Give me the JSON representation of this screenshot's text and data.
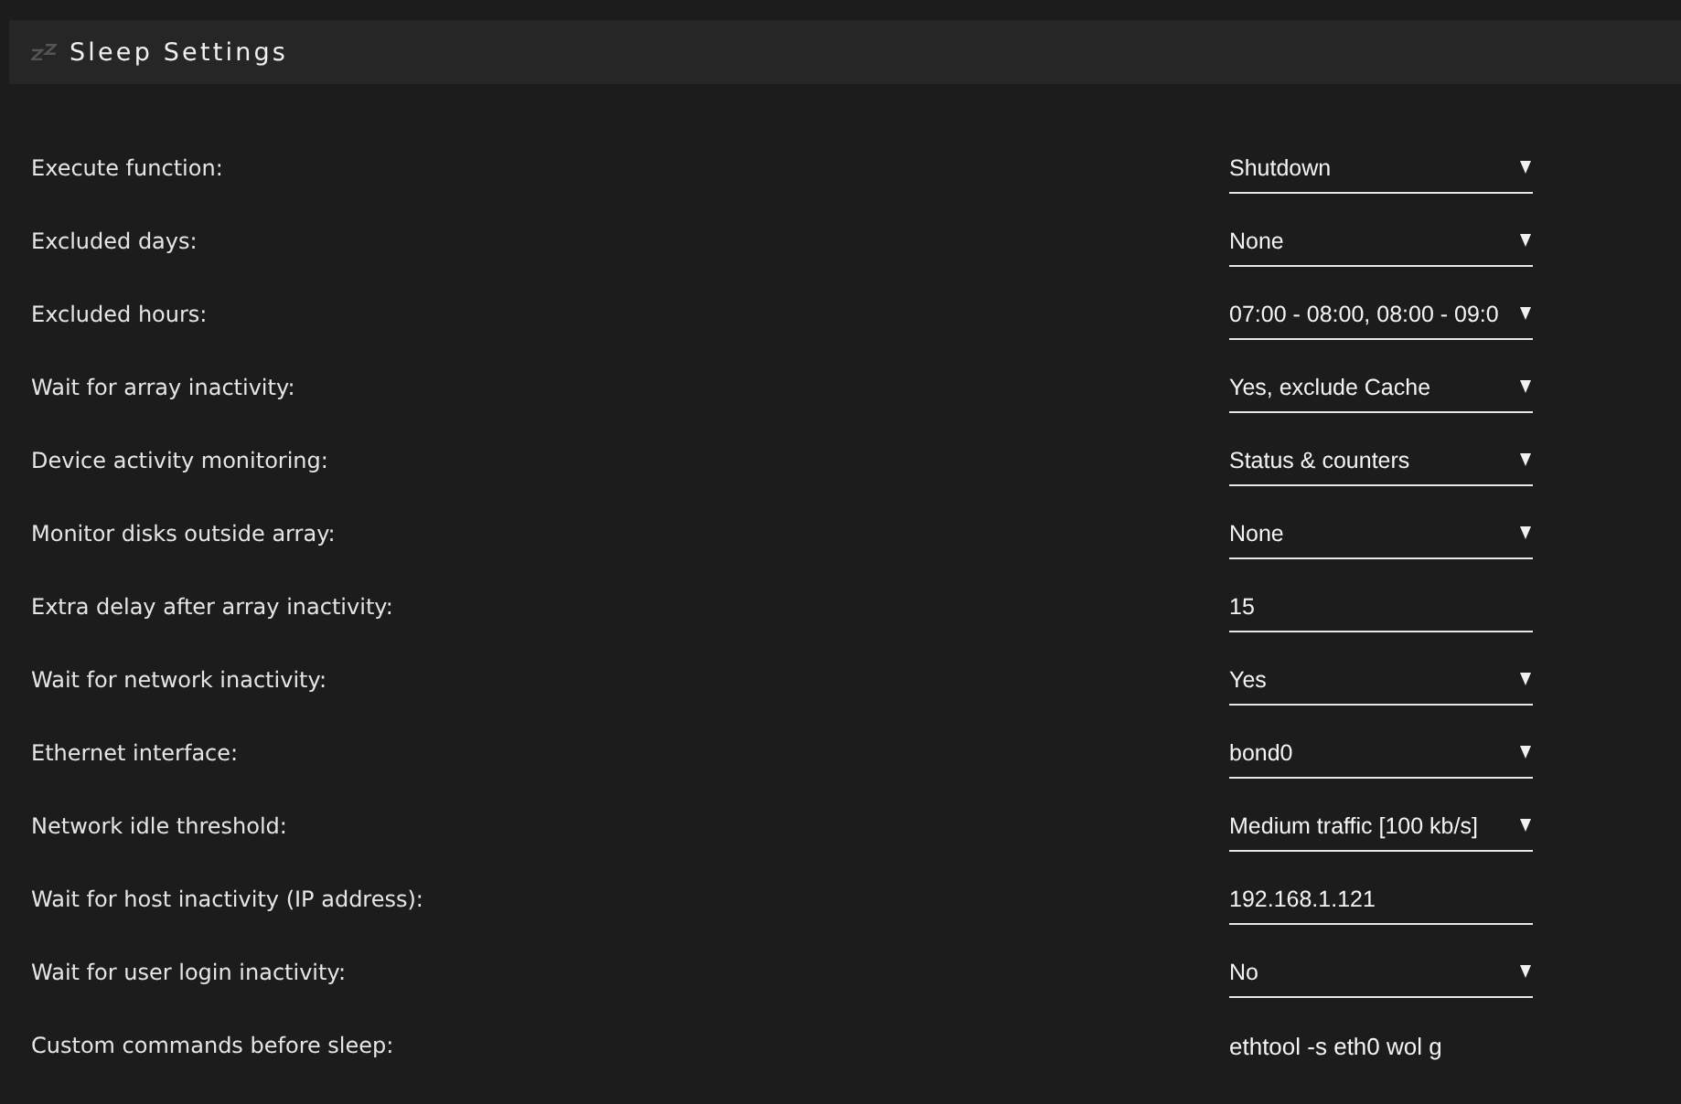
{
  "header": {
    "title": "Sleep Settings"
  },
  "settings": [
    {
      "label": "Execute function:",
      "kind": "select",
      "value": "Shutdown"
    },
    {
      "label": "Excluded days:",
      "kind": "select",
      "value": "None"
    },
    {
      "label": "Excluded hours:",
      "kind": "select",
      "value": "07:00 - 08:00, 08:00 - 09:0"
    },
    {
      "label": "Wait for array inactivity:",
      "kind": "select",
      "value": "Yes, exclude Cache"
    },
    {
      "label": "Device activity monitoring:",
      "kind": "select",
      "value": "Status & counters"
    },
    {
      "label": "Monitor disks outside array:",
      "kind": "select",
      "value": "None"
    },
    {
      "label": "Extra delay after array inactivity:",
      "kind": "input",
      "value": "15"
    },
    {
      "label": "Wait for network inactivity:",
      "kind": "select",
      "value": "Yes"
    },
    {
      "label": "Ethernet interface:",
      "kind": "select",
      "value": "bond0"
    },
    {
      "label": "Network idle threshold:",
      "kind": "select",
      "value": "Medium traffic [100 kb/s]"
    },
    {
      "label": "Wait for host inactivity (IP address):",
      "kind": "input",
      "value": "192.168.1.121"
    },
    {
      "label": "Wait for user login inactivity:",
      "kind": "select",
      "value": "No"
    },
    {
      "label": "Custom commands before sleep:",
      "kind": "text",
      "value": "ethtool -s eth0 wol g"
    }
  ]
}
